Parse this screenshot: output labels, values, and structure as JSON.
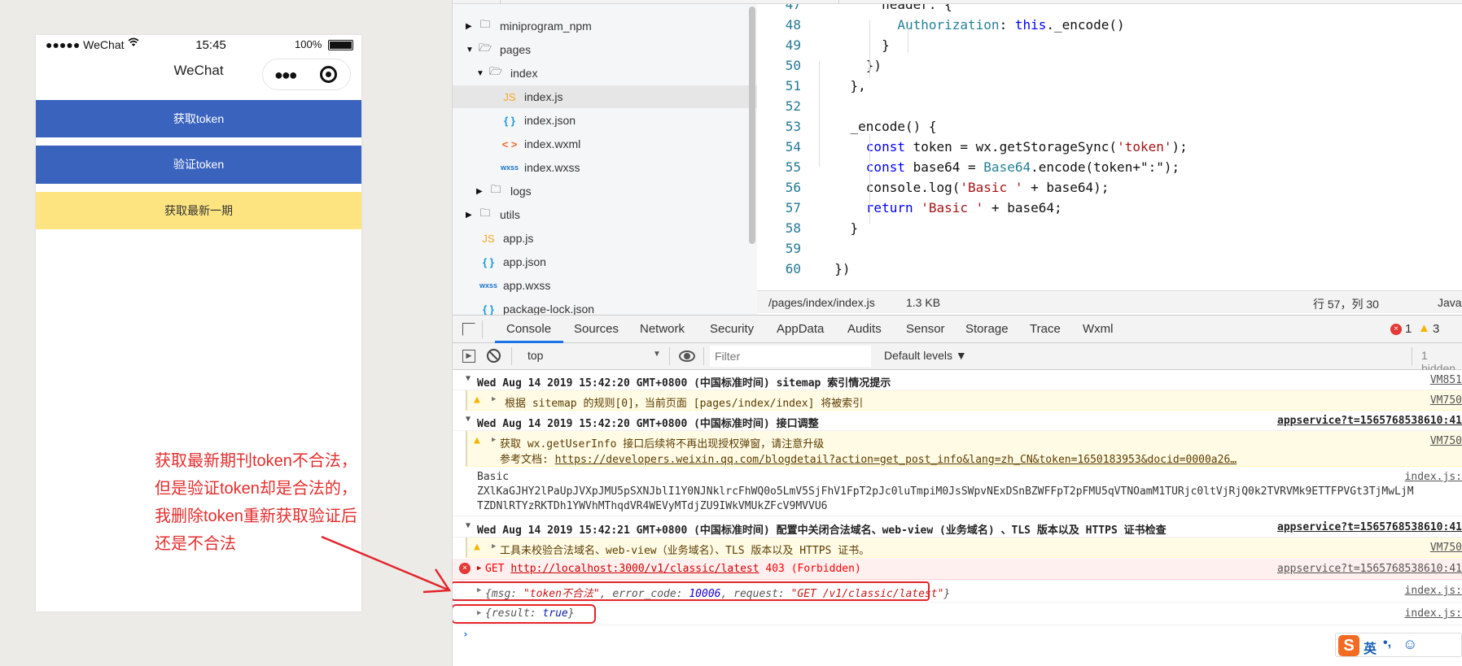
{
  "simulator": {
    "status_bar": {
      "signal": "●●●●● WeChat",
      "time": "15:45",
      "battery": "100%"
    },
    "nav_title": "WeChat",
    "buttons": [
      {
        "label": "获取token",
        "color": "#3a63be"
      },
      {
        "label": "验证token",
        "color": "#3a63be"
      },
      {
        "label": "获取最新一期",
        "color": "#fde480"
      }
    ]
  },
  "file_tree": {
    "items": [
      {
        "name": "miniprogram_npm",
        "type": "folder",
        "expanded": false
      },
      {
        "name": "pages",
        "type": "folder",
        "expanded": true
      },
      {
        "name": "index",
        "type": "folder",
        "expanded": true
      },
      {
        "name": "index.js",
        "type": "js",
        "selected": true
      },
      {
        "name": "index.json",
        "type": "json"
      },
      {
        "name": "index.wxml",
        "type": "wxml"
      },
      {
        "name": "index.wxss",
        "type": "wxss"
      },
      {
        "name": "logs",
        "type": "folder",
        "expanded": false
      },
      {
        "name": "utils",
        "type": "folder",
        "expanded": false
      },
      {
        "name": "app.js",
        "type": "js"
      },
      {
        "name": "app.json",
        "type": "json"
      },
      {
        "name": "app.wxss",
        "type": "wxss"
      },
      {
        "name": "package-lock.json",
        "type": "json"
      }
    ],
    "icons": {
      "js": "JS",
      "json": "{ }",
      "wxml": "< >",
      "wxss": "wxss"
    }
  },
  "editor": {
    "lines": [
      {
        "n": "47",
        "tokens": [
          {
            "t": "        header: {",
            "c": "plain"
          }
        ]
      },
      {
        "n": "48",
        "tokens": [
          {
            "t": "          Authorization",
            "c": "prop"
          },
          {
            "t": ": ",
            "c": "plain"
          },
          {
            "t": "this",
            "c": "kw"
          },
          {
            "t": "._encode()",
            "c": "plain"
          }
        ]
      },
      {
        "n": "49",
        "tokens": [
          {
            "t": "        }",
            "c": "plain"
          }
        ]
      },
      {
        "n": "50",
        "tokens": [
          {
            "t": "      })",
            "c": "plain"
          }
        ]
      },
      {
        "n": "51",
        "tokens": [
          {
            "t": "    },",
            "c": "plain"
          }
        ]
      },
      {
        "n": "52",
        "tokens": []
      },
      {
        "n": "53",
        "tokens": [
          {
            "t": "    _encode() {",
            "c": "plain"
          }
        ]
      },
      {
        "n": "54",
        "tokens": [
          {
            "t": "      ",
            "c": "plain"
          },
          {
            "t": "const",
            "c": "kw"
          },
          {
            "t": " token = wx.getStorageSync(",
            "c": "plain"
          },
          {
            "t": "'token'",
            "c": "str"
          },
          {
            "t": ");",
            "c": "plain"
          }
        ]
      },
      {
        "n": "55",
        "tokens": [
          {
            "t": "      ",
            "c": "plain"
          },
          {
            "t": "const",
            "c": "kw"
          },
          {
            "t": " base64 = ",
            "c": "plain"
          },
          {
            "t": "Base64",
            "c": "cls"
          },
          {
            "t": ".encode(token+\":\");",
            "c": "plain"
          }
        ]
      },
      {
        "n": "56",
        "tokens": [
          {
            "t": "      console.log(",
            "c": "plain"
          },
          {
            "t": "'Basic '",
            "c": "str"
          },
          {
            "t": " + base64);",
            "c": "plain"
          }
        ]
      },
      {
        "n": "57",
        "tokens": [
          {
            "t": "      ",
            "c": "plain"
          },
          {
            "t": "return",
            "c": "kw"
          },
          {
            "t": " ",
            "c": "plain"
          },
          {
            "t": "'Basic '",
            "c": "str"
          },
          {
            "t": " + base64;",
            "c": "plain"
          }
        ]
      },
      {
        "n": "58",
        "tokens": [
          {
            "t": "    }",
            "c": "plain"
          }
        ]
      },
      {
        "n": "59",
        "tokens": []
      },
      {
        "n": "60",
        "tokens": [
          {
            "t": "  })",
            "c": "plain"
          }
        ]
      }
    ],
    "status": {
      "path": "/pages/index/index.js",
      "size": "1.3 KB",
      "cursor": "行 57，列 30",
      "language": "JavaScript"
    }
  },
  "devtools": {
    "tabs": [
      "Console",
      "Sources",
      "Network",
      "Security",
      "AppData",
      "Audits",
      "Sensor",
      "Storage",
      "Trace",
      "Wxml"
    ],
    "active_tab": "Console",
    "error_count": "1",
    "warning_count": "3",
    "context": "top",
    "filter_placeholder": "Filter",
    "levels": "Default levels ▼",
    "hidden": "1 hidden"
  },
  "console": {
    "g1_header": "Wed Aug 14 2019 15:42:20 GMT+0800 (中国标准时间) sitemap 索引情况提示",
    "g1_src": "VM851",
    "g1_msg": "根据 sitemap 的规则[0]，当前页面 [pages/index/index] 将被索引",
    "g1_msg_src": "VM750",
    "g2_header": "Wed Aug 14 2019 15:42:20 GMT+0800 (中国标准时间) 接口调整",
    "g2_src": "appservice?t=1565768538610:41",
    "g2_msg": "获取 wx.getUserInfo 接口后续将不再出现授权弹窗，请注意升级",
    "g2_doc_label": "参考文档: ",
    "g2_doc_url": "https://developers.weixin.qq.com/blogdetail?action=get_post_info&lang=zh_CN&token=1650183953&docid=0000a26…",
    "g2_msg_src": "VM750",
    "log_basic_1": "Basic",
    "log_basic_2": "ZXlKaGJHY2lPaUpJVXpJMU5pSXNJblI1Y0NJNklrcFhWQ0o5LmV5SjFhV1FpT2pJc0luTmpiM0JsSWpvNExDSnBZWFFpT2pFMU5qVTNOamM1TURjc0ltVjRjQ0k2TVRVMk9ETTFPVGt3TjMwLjM",
    "log_basic_3": "TZDNlRTYzRKTDh1YWVhMThqdVR4WEVyMTdjZU9IWkVMUkZFcV9MVVU6",
    "log_basic_src": "index.js:",
    "g3_header": "Wed Aug 14 2019 15:42:21 GMT+0800 (中国标准时间) 配置中关闭合法域名、web-view (业务域名) 、TLS 版本以及 HTTPS 证书检查",
    "g3_src": "appservice?t=1565768538610:41",
    "g3_msg": "工具未校验合法域名、web-view（业务域名）、TLS 版本以及 HTTPS 证书。",
    "g3_msg_src": "VM750",
    "err_method": "GET ",
    "err_url": "http://localhost:3000/v1/classic/latest",
    "err_status": " 403 (Forbidden)",
    "err_src": "appservice?t=1565768538610:41",
    "obj1": {
      "msg_key": "msg: ",
      "msg_val": "\"token不合法\"",
      "code_key": ", error_code: ",
      "code_val": "10006",
      "req_key": ", request: ",
      "req_val": "\"GET /v1/classic/latest\"",
      "src": "index.js:"
    },
    "obj2": {
      "key": "result: ",
      "val": "true",
      "src": "index.js:"
    }
  },
  "annotation": {
    "text": "获取最新期刊token不合法，但是验证token却是合法的，我删除token重新获取验证后还是不合法",
    "color": "#e52d2d"
  },
  "ime": {
    "label": "英"
  }
}
